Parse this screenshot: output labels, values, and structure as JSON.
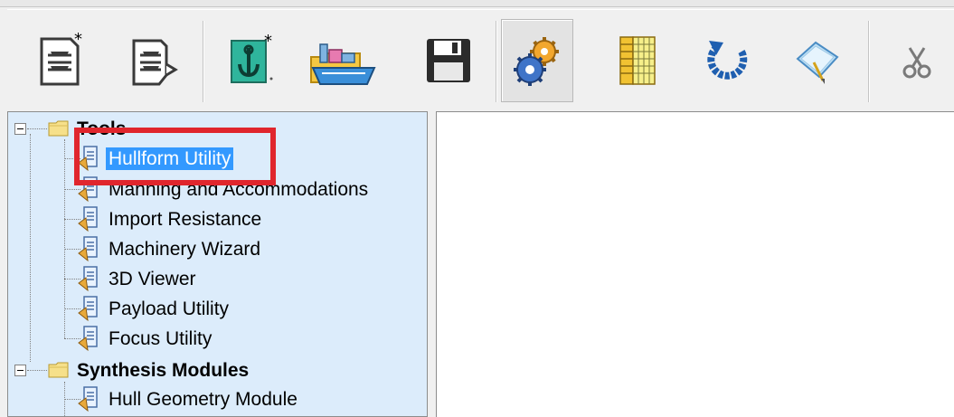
{
  "toolbar": {
    "buttons": [
      {
        "name": "new-ship-button",
        "icon": "new-document-icon"
      },
      {
        "name": "open-ship-button",
        "icon": "open-document-icon"
      },
      {
        "name": "new-project-button",
        "icon": "anchor-new-icon"
      },
      {
        "name": "open-project-button",
        "icon": "ship-folder-icon"
      },
      {
        "name": "save-button",
        "icon": "floppy-disk-icon"
      },
      {
        "name": "settings-button",
        "icon": "gears-icon"
      },
      {
        "name": "table-button",
        "icon": "grid-table-icon"
      },
      {
        "name": "refresh-button",
        "icon": "refresh-arrow-icon"
      },
      {
        "name": "edit-button",
        "icon": "pen-diamond-icon"
      },
      {
        "name": "cut-button",
        "icon": "scissors-icon"
      }
    ]
  },
  "tree": {
    "groups": [
      {
        "label": "Tools",
        "items": [
          "Hullform Utility",
          "Manning and Accommodations",
          "Import Resistance",
          "Machinery Wizard",
          "3D Viewer",
          "Payload Utility",
          "Focus Utility"
        ]
      },
      {
        "label": "Synthesis Modules",
        "items": [
          "Hull Geometry Module"
        ]
      }
    ],
    "selected_item": "Hullform Utility"
  },
  "colors": {
    "tree_background": "#dcecfb",
    "selection": "#3399ff",
    "highlight_box": "#e0262d"
  }
}
